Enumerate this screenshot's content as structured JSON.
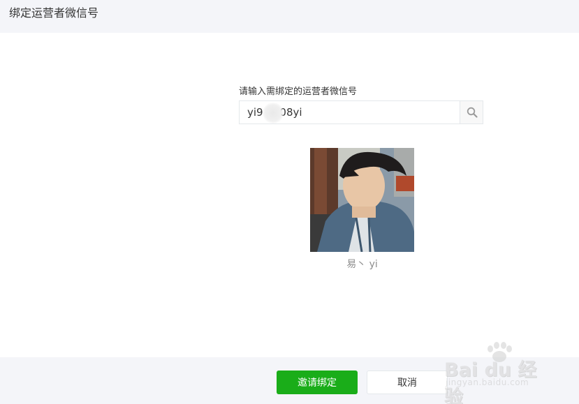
{
  "header": {
    "title": "绑定运营者微信号"
  },
  "search": {
    "label": "请输入需绑定的运营者微信号",
    "value": "yi9     08yi",
    "search_icon": "search-icon"
  },
  "result": {
    "avatar": "user-photo",
    "nickname": "易丶 yi"
  },
  "footer": {
    "invite_label": "邀请绑定",
    "cancel_label": "取消"
  },
  "watermark": {
    "brand": "Bai du 经验",
    "url": "jingyan.baidu.com"
  },
  "colors": {
    "primary": "#1aad19",
    "header_bg": "#f4f5f9",
    "border": "#e4e8eb"
  }
}
